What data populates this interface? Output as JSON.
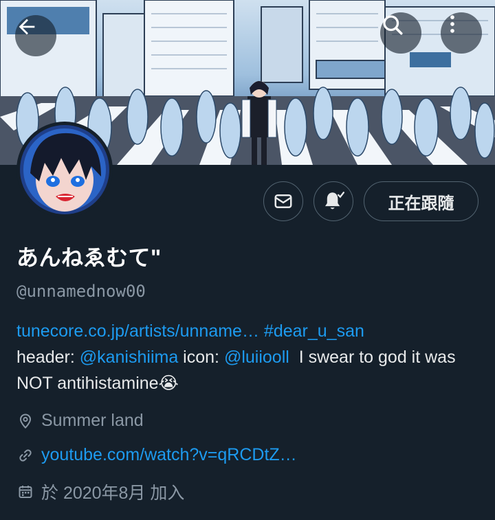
{
  "header": {
    "back_icon": "arrow-left-icon",
    "search_icon": "search-icon",
    "more_icon": "more-vertical-icon"
  },
  "profile": {
    "display_name": "あんねゑむて\"",
    "handle": "@unnamednow00",
    "follow_label": "正在跟隨",
    "message_icon": "mail-icon",
    "notify_icon": "bell-check-icon"
  },
  "bio": {
    "link_text": "tunecore.co.jp/artists/unname…",
    "hashtag": "#dear_u_san",
    "header_prefix": "header: ",
    "header_mention": "@kanishiima",
    "icon_prefix": " icon: ",
    "icon_mention": "@luiiooll",
    "tail": "  I swear to god it was NOT antihistamine😭"
  },
  "meta": {
    "location": "Summer land",
    "website": "youtube.com/watch?v=qRCDtZ…",
    "joined": "於 2020年8月 加入"
  },
  "colors": {
    "background": "#15202b",
    "link": "#1d9bf0",
    "secondary_text": "#8b98a5",
    "border": "#536471"
  }
}
